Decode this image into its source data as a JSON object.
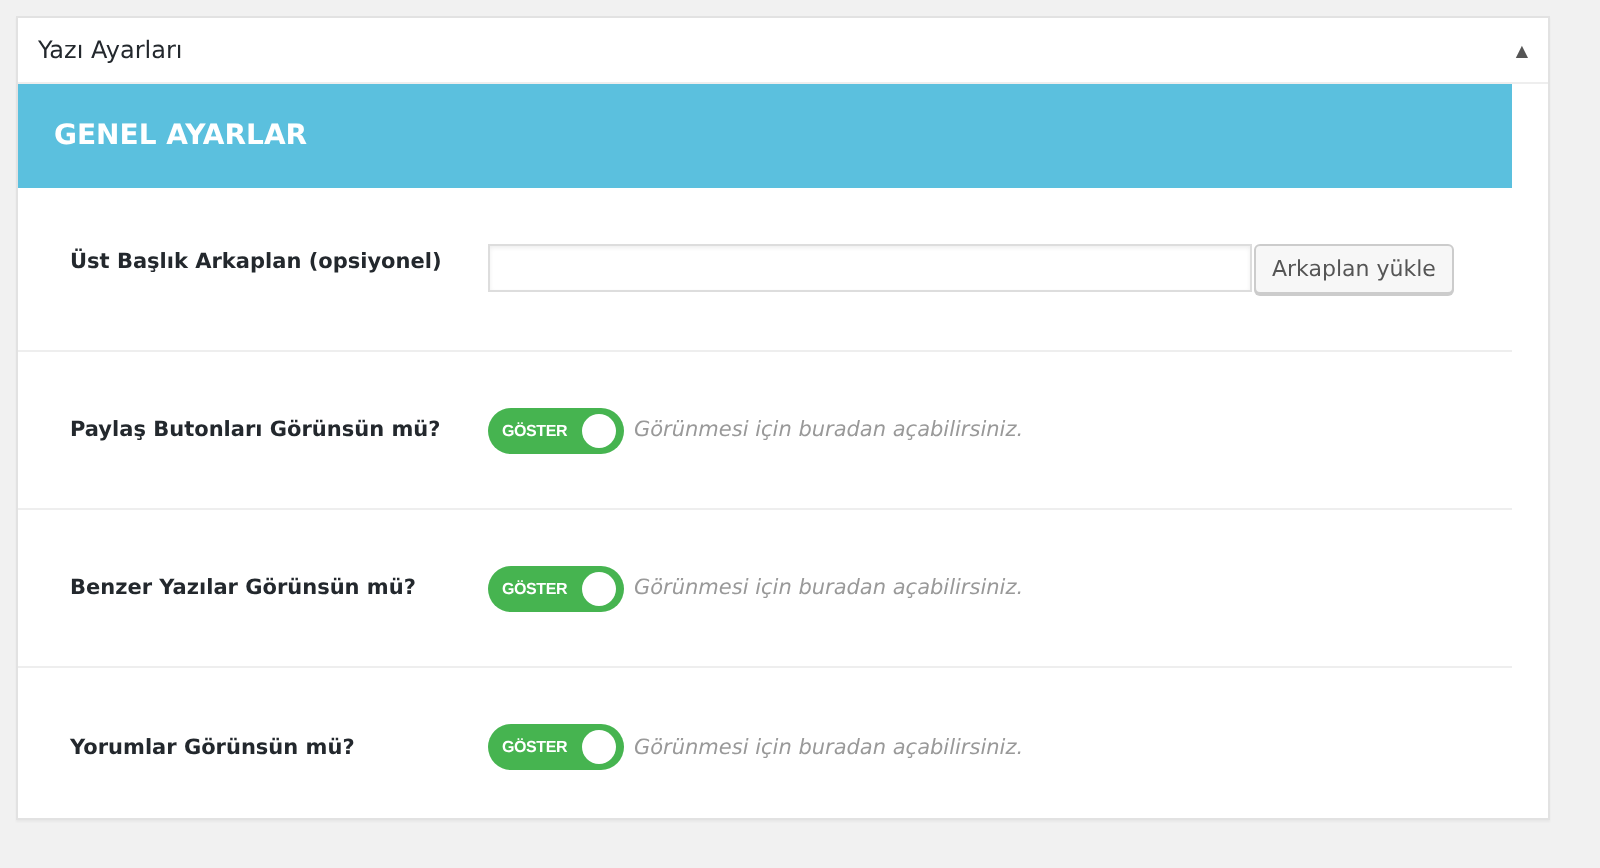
{
  "panel": {
    "title": "Yazı Ayarları",
    "collapse_icon": "▲"
  },
  "section": {
    "title": "GENEL AYARLAR"
  },
  "rows": [
    {
      "kind": "upload",
      "label": "Üst Başlık Arkaplan (opsiyonel)",
      "button": "Arkaplan yükle"
    },
    {
      "kind": "toggle",
      "label": "Paylaş Butonları Görünsün mü?",
      "on": true,
      "toggle_text": "GÖSTER",
      "hint": "Görünmesi için buradan açabilirsiniz."
    },
    {
      "kind": "toggle",
      "label": "Benzer Yazılar Görünsün mü?",
      "on": true,
      "toggle_text": "GÖSTER",
      "hint": "Görünmesi için buradan açabilirsiniz."
    },
    {
      "kind": "toggle",
      "label": "Yorumlar Görünsün mü?",
      "on": true,
      "toggle_text": "GÖSTER",
      "hint": "Görünmesi için buradan açabilirsiniz."
    }
  ]
}
